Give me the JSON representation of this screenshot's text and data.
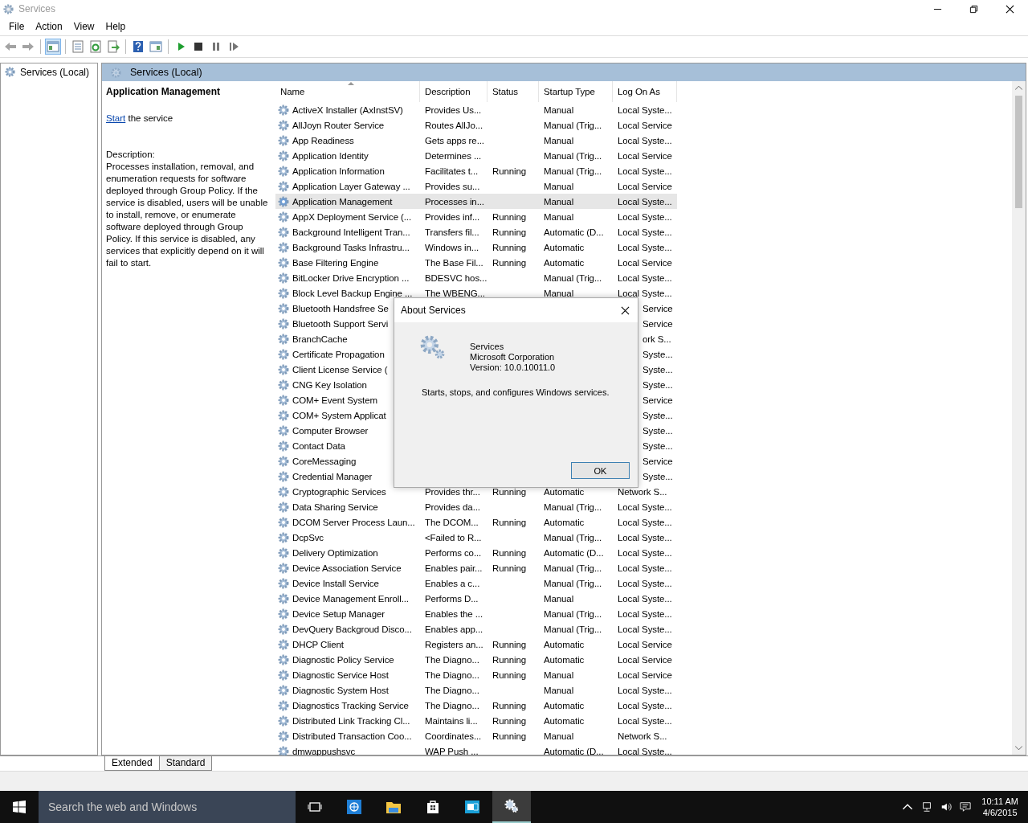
{
  "window": {
    "title": "Services"
  },
  "menu": [
    "File",
    "Action",
    "View",
    "Help"
  ],
  "toolbar": [
    [
      {
        "kind": "back",
        "pressed": false,
        "disabled": true
      },
      {
        "kind": "forward",
        "pressed": false,
        "disabled": true
      }
    ],
    [
      {
        "kind": "tree",
        "pressed": true,
        "disabled": false
      }
    ],
    [
      {
        "kind": "properties",
        "pressed": false,
        "disabled": false
      },
      {
        "kind": "refresh",
        "pressed": false,
        "disabled": false
      },
      {
        "kind": "export",
        "pressed": false,
        "disabled": false
      }
    ],
    [
      {
        "kind": "help",
        "pressed": false,
        "disabled": false
      },
      {
        "kind": "actionpane",
        "pressed": false,
        "disabled": false
      }
    ],
    [
      {
        "kind": "play",
        "pressed": false,
        "disabled": false
      },
      {
        "kind": "stop",
        "pressed": false,
        "disabled": false
      },
      {
        "kind": "pause",
        "pressed": false,
        "disabled": false
      },
      {
        "kind": "resume",
        "pressed": false,
        "disabled": false
      }
    ]
  ],
  "tree": {
    "items": [
      {
        "label": "Services (Local)",
        "selected": false
      }
    ]
  },
  "panel_header": "Services (Local)",
  "details": {
    "title": "Application Management",
    "link": "Start",
    "link_rest": "the service",
    "description_label": "Description:",
    "description": "Processes installation, removal, and enumeration requests for software deployed through Group Policy. If the service is disabled, users will be unable to install, remove, or enumerate software deployed through Group Policy. If this service is disabled, any services that explicitly depend on it will fail to start."
  },
  "table": {
    "columns": [
      {
        "label": "Name",
        "sorted": true
      },
      {
        "label": "Description",
        "sorted": false
      },
      {
        "label": "Status",
        "sorted": false
      },
      {
        "label": "Startup Type",
        "sorted": false
      },
      {
        "label": "Log On As",
        "sorted": false
      }
    ],
    "rows": [
      {
        "name": "ActiveX Installer (AxInstSV)",
        "description": "Provides Us...",
        "status": "",
        "startup": "Manual",
        "logon": "Local Syste...",
        "selected": false,
        "covered": false
      },
      {
        "name": "AllJoyn Router Service",
        "description": "Routes AllJo...",
        "status": "",
        "startup": "Manual (Trig...",
        "logon": "Local Service",
        "selected": false,
        "covered": false
      },
      {
        "name": "App Readiness",
        "description": "Gets apps re...",
        "status": "",
        "startup": "Manual",
        "logon": "Local Syste...",
        "selected": false,
        "covered": false
      },
      {
        "name": "Application Identity",
        "description": "Determines ...",
        "status": "",
        "startup": "Manual (Trig...",
        "logon": "Local Service",
        "selected": false,
        "covered": false
      },
      {
        "name": "Application Information",
        "description": "Facilitates t...",
        "status": "Running",
        "startup": "Manual (Trig...",
        "logon": "Local Syste...",
        "selected": false,
        "covered": false
      },
      {
        "name": "Application Layer Gateway ...",
        "description": "Provides su...",
        "status": "",
        "startup": "Manual",
        "logon": "Local Service",
        "selected": false,
        "covered": false
      },
      {
        "name": "Application Management",
        "description": "Processes in...",
        "status": "",
        "startup": "Manual",
        "logon": "Local Syste...",
        "selected": true,
        "covered": false
      },
      {
        "name": "AppX Deployment Service (...",
        "description": "Provides inf...",
        "status": "Running",
        "startup": "Manual",
        "logon": "Local Syste...",
        "selected": false,
        "covered": false
      },
      {
        "name": "Background Intelligent Tran...",
        "description": "Transfers fil...",
        "status": "Running",
        "startup": "Automatic (D...",
        "logon": "Local Syste...",
        "selected": false,
        "covered": false
      },
      {
        "name": "Background Tasks Infrastru...",
        "description": "Windows in...",
        "status": "Running",
        "startup": "Automatic",
        "logon": "Local Syste...",
        "selected": false,
        "covered": false
      },
      {
        "name": "Base Filtering Engine",
        "description": "The Base Fil...",
        "status": "Running",
        "startup": "Automatic",
        "logon": "Local Service",
        "selected": false,
        "covered": false
      },
      {
        "name": "BitLocker Drive Encryption ...",
        "description": "BDESVC hos...",
        "status": "",
        "startup": "Manual (Trig...",
        "logon": "Local Syste...",
        "selected": false,
        "covered": false
      },
      {
        "name": "Block Level Backup Engine ...",
        "description": "The WBENG...",
        "status": "",
        "startup": "Manual",
        "logon": "Local Syste...",
        "selected": false,
        "covered": false
      },
      {
        "name": "Bluetooth Handsfree Se",
        "logon": "Service",
        "selected": false,
        "covered": true
      },
      {
        "name": "Bluetooth Support Servi",
        "logon": "Service",
        "selected": false,
        "covered": true
      },
      {
        "name": "BranchCache",
        "logon": "ork S...",
        "selected": false,
        "covered": true
      },
      {
        "name": "Certificate Propagation",
        "logon": "Syste...",
        "selected": false,
        "covered": true
      },
      {
        "name": "Client License Service (",
        "logon": "Syste...",
        "selected": false,
        "covered": true
      },
      {
        "name": "CNG Key Isolation",
        "logon": "Syste...",
        "selected": false,
        "covered": true
      },
      {
        "name": "COM+ Event System",
        "logon": "Service",
        "selected": false,
        "covered": true
      },
      {
        "name": "COM+ System Applicat",
        "logon": "Syste...",
        "selected": false,
        "covered": true
      },
      {
        "name": "Computer Browser",
        "logon": "Syste...",
        "selected": false,
        "covered": true
      },
      {
        "name": "Contact Data",
        "logon": "Syste...",
        "selected": false,
        "covered": true
      },
      {
        "name": "CoreMessaging",
        "logon": "Service",
        "selected": false,
        "covered": true
      },
      {
        "name": "Credential Manager",
        "logon": "Syste...",
        "selected": false,
        "covered": true
      },
      {
        "name": "Cryptographic Services",
        "description": "Provides thr...",
        "status": "Running",
        "startup": "Automatic",
        "logon": "Network S...",
        "selected": false,
        "covered": false
      },
      {
        "name": "Data Sharing Service",
        "description": "Provides da...",
        "status": "",
        "startup": "Manual (Trig...",
        "logon": "Local Syste...",
        "selected": false,
        "covered": false
      },
      {
        "name": "DCOM Server Process Laun...",
        "description": "The DCOM...",
        "status": "Running",
        "startup": "Automatic",
        "logon": "Local Syste...",
        "selected": false,
        "covered": false
      },
      {
        "name": "DcpSvc",
        "description": "<Failed to R...",
        "status": "",
        "startup": "Manual (Trig...",
        "logon": "Local Syste...",
        "selected": false,
        "covered": false
      },
      {
        "name": "Delivery Optimization",
        "description": "Performs co...",
        "status": "Running",
        "startup": "Automatic (D...",
        "logon": "Local Syste...",
        "selected": false,
        "covered": false
      },
      {
        "name": "Device Association Service",
        "description": "Enables pair...",
        "status": "Running",
        "startup": "Manual (Trig...",
        "logon": "Local Syste...",
        "selected": false,
        "covered": false
      },
      {
        "name": "Device Install Service",
        "description": "Enables a c...",
        "status": "",
        "startup": "Manual (Trig...",
        "logon": "Local Syste...",
        "selected": false,
        "covered": false
      },
      {
        "name": "Device Management Enroll...",
        "description": "Performs D...",
        "status": "",
        "startup": "Manual",
        "logon": "Local Syste...",
        "selected": false,
        "covered": false
      },
      {
        "name": "Device Setup Manager",
        "description": "Enables the ...",
        "status": "",
        "startup": "Manual (Trig...",
        "logon": "Local Syste...",
        "selected": false,
        "covered": false
      },
      {
        "name": "DevQuery Backgroud Disco...",
        "description": "Enables app...",
        "status": "",
        "startup": "Manual (Trig...",
        "logon": "Local Syste...",
        "selected": false,
        "covered": false
      },
      {
        "name": "DHCP Client",
        "description": "Registers an...",
        "status": "Running",
        "startup": "Automatic",
        "logon": "Local Service",
        "selected": false,
        "covered": false
      },
      {
        "name": "Diagnostic Policy Service",
        "description": "The Diagno...",
        "status": "Running",
        "startup": "Automatic",
        "logon": "Local Service",
        "selected": false,
        "covered": false
      },
      {
        "name": "Diagnostic Service Host",
        "description": "The Diagno...",
        "status": "Running",
        "startup": "Manual",
        "logon": "Local Service",
        "selected": false,
        "covered": false
      },
      {
        "name": "Diagnostic System Host",
        "description": "The Diagno...",
        "status": "",
        "startup": "Manual",
        "logon": "Local Syste...",
        "selected": false,
        "covered": false
      },
      {
        "name": "Diagnostics Tracking Service",
        "description": "The Diagno...",
        "status": "Running",
        "startup": "Automatic",
        "logon": "Local Syste...",
        "selected": false,
        "covered": false
      },
      {
        "name": "Distributed Link Tracking Cl...",
        "description": "Maintains li...",
        "status": "Running",
        "startup": "Automatic",
        "logon": "Local Syste...",
        "selected": false,
        "covered": false
      },
      {
        "name": "Distributed Transaction Coo...",
        "description": "Coordinates...",
        "status": "Running",
        "startup": "Manual",
        "logon": "Network S...",
        "selected": false,
        "covered": false
      },
      {
        "name": "dmwappushsvc",
        "description": "WAP Push ...",
        "status": "",
        "startup": "Automatic (D...",
        "logon": "Local Syste...",
        "selected": false,
        "covered": false
      }
    ]
  },
  "view_tabs": [
    {
      "label": "Extended",
      "selected": true
    },
    {
      "label": "Standard",
      "selected": false
    }
  ],
  "dialog": {
    "title": "About Services",
    "product": "Services",
    "company": "Microsoft Corporation",
    "version": "Version: 10.0.10011.0",
    "summary": "Starts, stops, and configures Windows services.",
    "ok": "OK"
  },
  "taskbar": {
    "search_placeholder": "Search the web and Windows",
    "apps": [
      {
        "kind": "taskview",
        "selected": false
      },
      {
        "kind": "browser",
        "selected": false
      },
      {
        "kind": "folder",
        "selected": false
      },
      {
        "kind": "store",
        "selected": false
      },
      {
        "kind": "mail",
        "selected": false
      },
      {
        "kind": "services",
        "selected": true
      }
    ],
    "time": "10:11 AM",
    "date": "4/6/2015"
  }
}
